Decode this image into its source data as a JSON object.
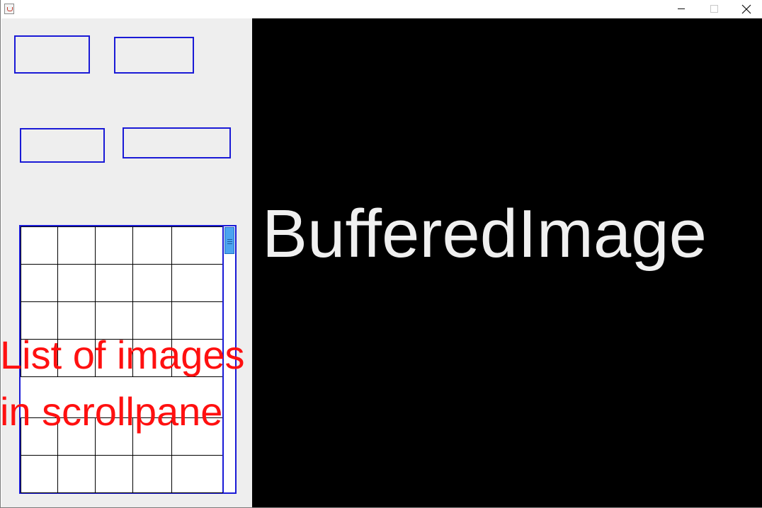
{
  "window": {
    "app_icon": "java-cup-icon",
    "controls": {
      "minimize_icon": "minimize-icon",
      "maximize_icon": "maximize-icon",
      "close_icon": "close-icon"
    }
  },
  "left_panel": {
    "annotation_line1": "List of images",
    "annotation_line2": "in scrollpane",
    "annotation_color": "#ff1010",
    "box_border_color": "#1a1ad6",
    "scrollbar_thumb_color": "#4aa3f0"
  },
  "canvas": {
    "label": "BufferedImage",
    "background": "#000000"
  }
}
